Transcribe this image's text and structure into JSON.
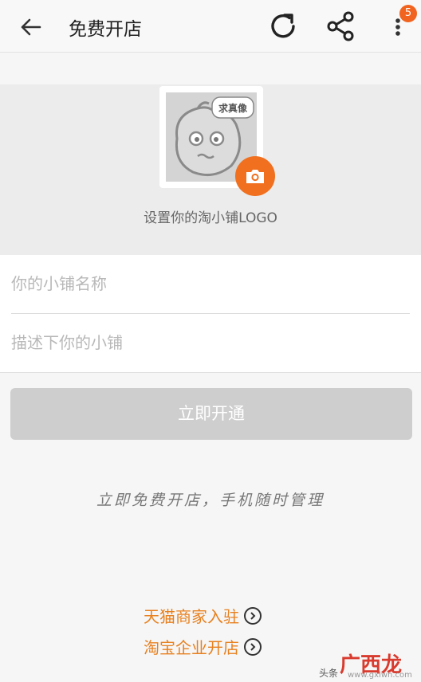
{
  "header": {
    "title": "免费开店",
    "badge_count": "5"
  },
  "logo": {
    "placeholder_caption": "求真像",
    "label": "设置你的淘小铺LOGO"
  },
  "form": {
    "name_placeholder": "你的小铺名称",
    "desc_placeholder": "描述下你的小铺"
  },
  "actions": {
    "open_label": "立即开通"
  },
  "slogan": "立即免费开店，手机随时管理",
  "links": {
    "tmall": "天猫商家入驻",
    "taobao_enterprise": "淘宝企业开店"
  },
  "watermark": {
    "text": "广西龙网",
    "small": "头条",
    "url": "www.gxlwn.com"
  },
  "colors": {
    "accent": "#f1641f",
    "link": "#e8801e",
    "button_disabled": "#cecece"
  }
}
